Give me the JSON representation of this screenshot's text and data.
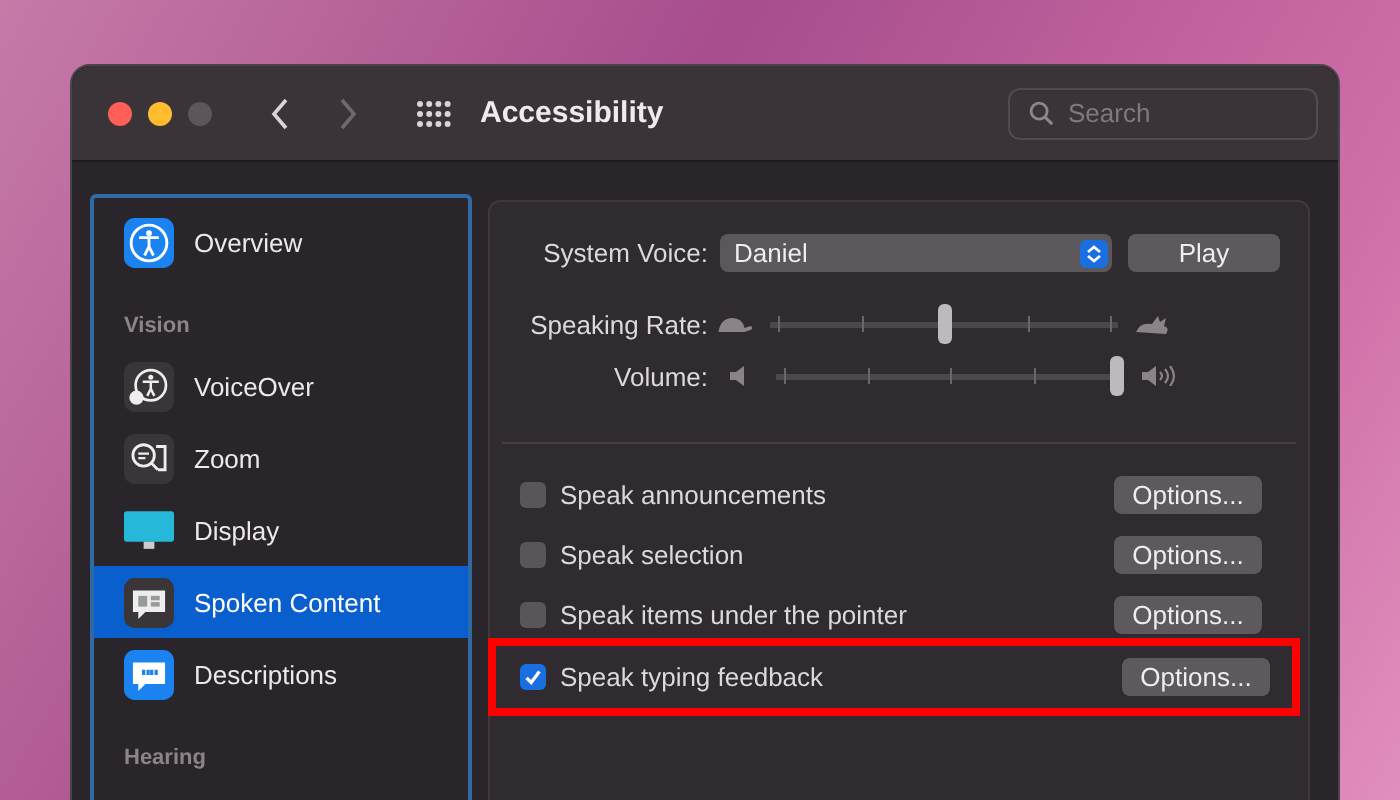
{
  "window": {
    "title": "Accessibility"
  },
  "toolbar": {
    "search": {
      "placeholder": "Search"
    }
  },
  "sidebar": {
    "items": [
      {
        "kind": "item",
        "label": "Overview",
        "selected": false
      },
      {
        "kind": "section",
        "label": "Vision"
      },
      {
        "kind": "item",
        "label": "VoiceOver",
        "selected": false
      },
      {
        "kind": "item",
        "label": "Zoom",
        "selected": false
      },
      {
        "kind": "item",
        "label": "Display",
        "selected": false
      },
      {
        "kind": "item",
        "label": "Spoken Content",
        "selected": true
      },
      {
        "kind": "item",
        "label": "Descriptions",
        "selected": false
      },
      {
        "kind": "section",
        "label": "Hearing"
      }
    ]
  },
  "content": {
    "system_voice": {
      "label": "System Voice:",
      "value": "Daniel",
      "button": "Play"
    },
    "sliders": [
      {
        "label": "Speaking Rate:",
        "level": 0.5,
        "kind": "rate"
      },
      {
        "label": "Volume:",
        "level": 1.0,
        "kind": "volume"
      }
    ],
    "options": [
      {
        "label": "Speak announcements",
        "checked": false,
        "button": "Options...",
        "highlighted": false
      },
      {
        "label": "Speak selection",
        "checked": false,
        "button": "Options...",
        "highlighted": false
      },
      {
        "label": "Speak items under the pointer",
        "checked": false,
        "button": "Options...",
        "highlighted": false
      },
      {
        "label": "Speak typing feedback",
        "checked": true,
        "button": "Options...",
        "highlighted": true
      }
    ]
  }
}
